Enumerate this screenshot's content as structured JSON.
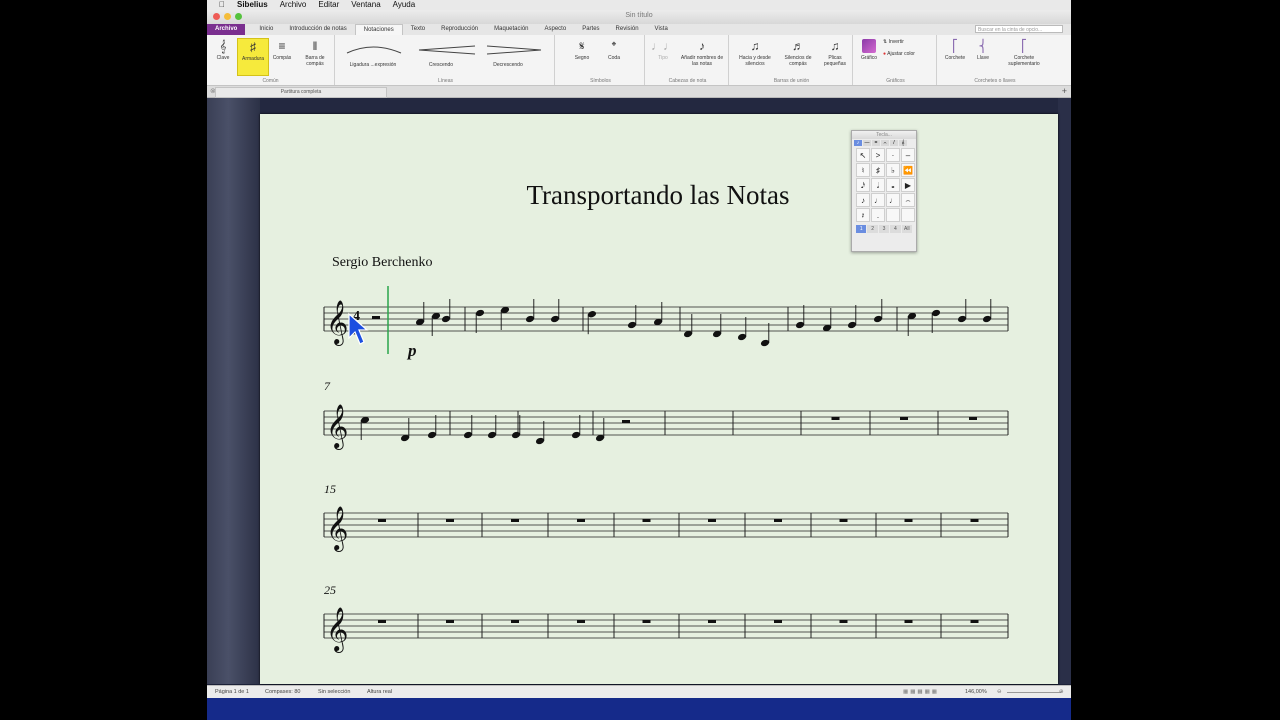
{
  "menubar": {
    "app": "Sibelius",
    "items": [
      "Archivo",
      "Editar",
      "Ventana",
      "Ayuda"
    ]
  },
  "window": {
    "title": "Sin título"
  },
  "ribbon_tabs": [
    "Archivo",
    "Inicio",
    "Introducción de notas",
    "Notaciones",
    "Texto",
    "Reproducción",
    "Maquetación",
    "Aspecto",
    "Partes",
    "Revisión",
    "Vista"
  ],
  "active_tab": "Notaciones",
  "ribbon_search_placeholder": "Buscar en la cinta de opcio...",
  "ribbon": {
    "comun": {
      "title": "Común",
      "clave": "Clave",
      "armadura": "Armadura",
      "compas": "Compás",
      "barra": "Barra de compás"
    },
    "lineas": {
      "title": "Líneas",
      "ligadura": "Ligadura ...expresión",
      "crescendo": "Crescendo",
      "decrescendo": "Decrescendo"
    },
    "simbolos": {
      "title": "Símbolos",
      "segno": "Segno",
      "coda": "Coda"
    },
    "cabezas": {
      "title": "Cabezas de nota",
      "tipo": "Tipo",
      "anadir": "Añadir nombres de las notas"
    },
    "barras_union": {
      "title": "Barras de unión",
      "hacia": "Hacia y desde silencios",
      "silencios": "Silencios de compás",
      "plicas": "Plicas pequeñas"
    },
    "graficos": {
      "title": "Gráficos",
      "grafico": "Gráfico",
      "invertir": "Invertir",
      "ajustar": "Ajustar color"
    },
    "corchetes": {
      "title": "Corchetes o llaves",
      "corchete": "Corchete",
      "llave": "Llave",
      "sup": "Corchete suplementario"
    }
  },
  "doc_tab": "Partitura completa",
  "score": {
    "title": "Transportando las Notas",
    "composer": "Sergio Berchenko",
    "time_signature": "4/4",
    "dynamic": "p",
    "measure_numbers": [
      "7",
      "15",
      "25"
    ]
  },
  "keypad": {
    "title": "Tecla...",
    "layouts": [
      "1",
      "2",
      "3",
      "4",
      "All"
    ]
  },
  "status": {
    "page": "Página 1 de 1",
    "bars": "Compases: 80",
    "selection": "Sin selección",
    "pitch": "Altura real",
    "zoom": "146,00%"
  }
}
